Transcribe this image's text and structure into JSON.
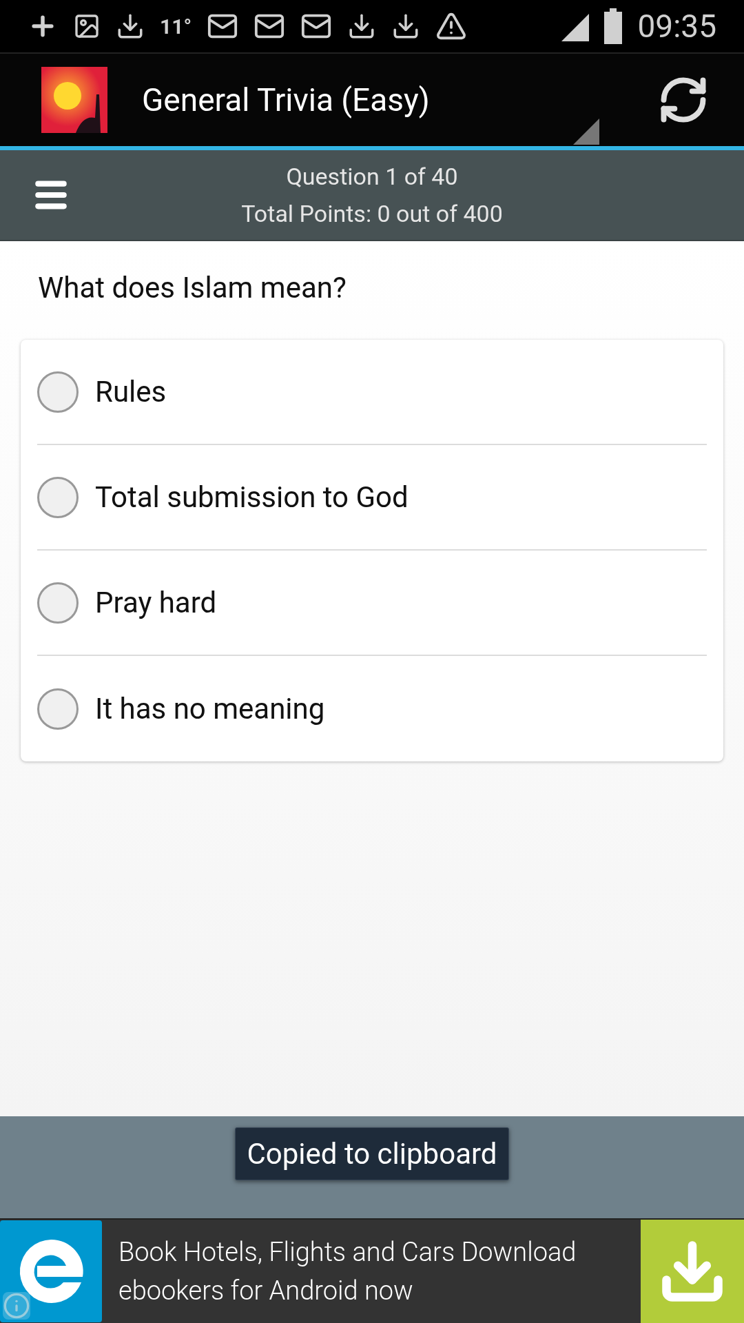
{
  "status_bar": {
    "temperature": "11°",
    "time": "09:35"
  },
  "app_bar": {
    "title": "General Trivia (Easy)"
  },
  "quiz_header": {
    "question_counter": "Question 1 of 40",
    "points": "Total Points: 0 out of 400"
  },
  "question": "What does Islam mean?",
  "options": [
    {
      "label": "Rules",
      "selected": false
    },
    {
      "label": "Total submission to God",
      "selected": false
    },
    {
      "label": "Pray hard",
      "selected": false
    },
    {
      "label": "It has no meaning",
      "selected": false
    }
  ],
  "toast": "Copied to clipboard",
  "ad": {
    "text": "Book Hotels, Flights and Cars Download ebookers for Android now"
  }
}
